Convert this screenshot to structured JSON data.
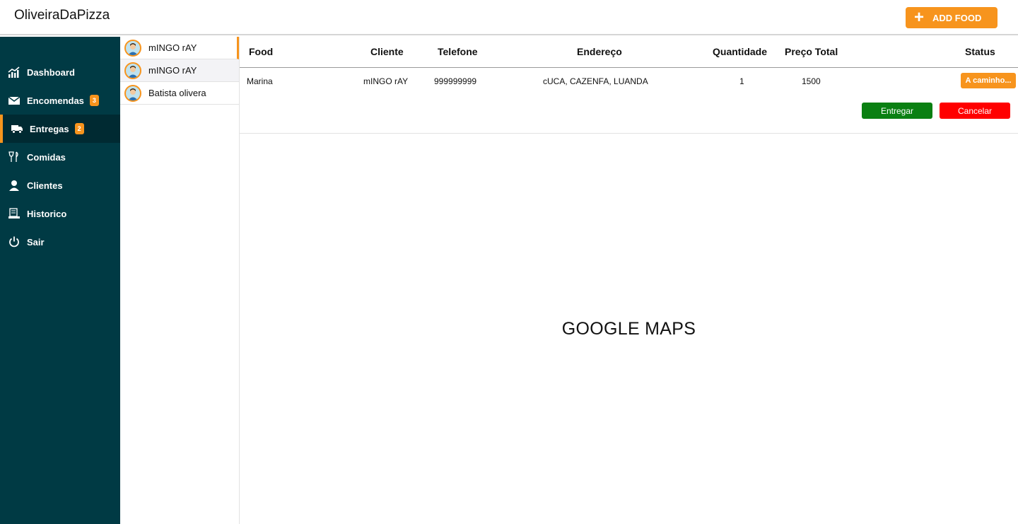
{
  "header": {
    "brand": "OliveiraDaPizza",
    "add_food_label": "ADD FOOD",
    "accent_color": "#f7941d"
  },
  "sidebar": {
    "background": "#003a44",
    "items": [
      {
        "label": "Dashboard",
        "icon": "chart-icon"
      },
      {
        "label": "Encomendas",
        "icon": "mail-icon",
        "badge": "3"
      },
      {
        "label": "Entregas",
        "icon": "truck-icon",
        "badge": "2",
        "active": true
      },
      {
        "label": "Comidas",
        "icon": "utensils-icon"
      },
      {
        "label": "Clientes",
        "icon": "user-icon"
      },
      {
        "label": "Historico",
        "icon": "history-icon"
      },
      {
        "label": "Sair",
        "icon": "power-icon"
      }
    ]
  },
  "clients": [
    {
      "name": "mINGO rAY"
    },
    {
      "name": "mINGO rAY"
    },
    {
      "name": "Batista olivera"
    }
  ],
  "table": {
    "headers": {
      "food": "Food",
      "cliente": "Cliente",
      "telefone": "Telefone",
      "endereco": "Endereço",
      "quantidade": "Quantidade",
      "preco": "Preço Total",
      "status": "Status"
    },
    "row": {
      "food": "Marina",
      "cliente": "mINGO rAY",
      "telefone": "999999999",
      "endereco": "cUCA, CAZENFA, LUANDA",
      "quantidade": "1",
      "preco": "1500",
      "status": "A caminho..."
    },
    "actions": {
      "entregar": "Entregar",
      "cancelar": "Cancelar"
    }
  },
  "map": {
    "label": "GOOGLE MAPS"
  }
}
